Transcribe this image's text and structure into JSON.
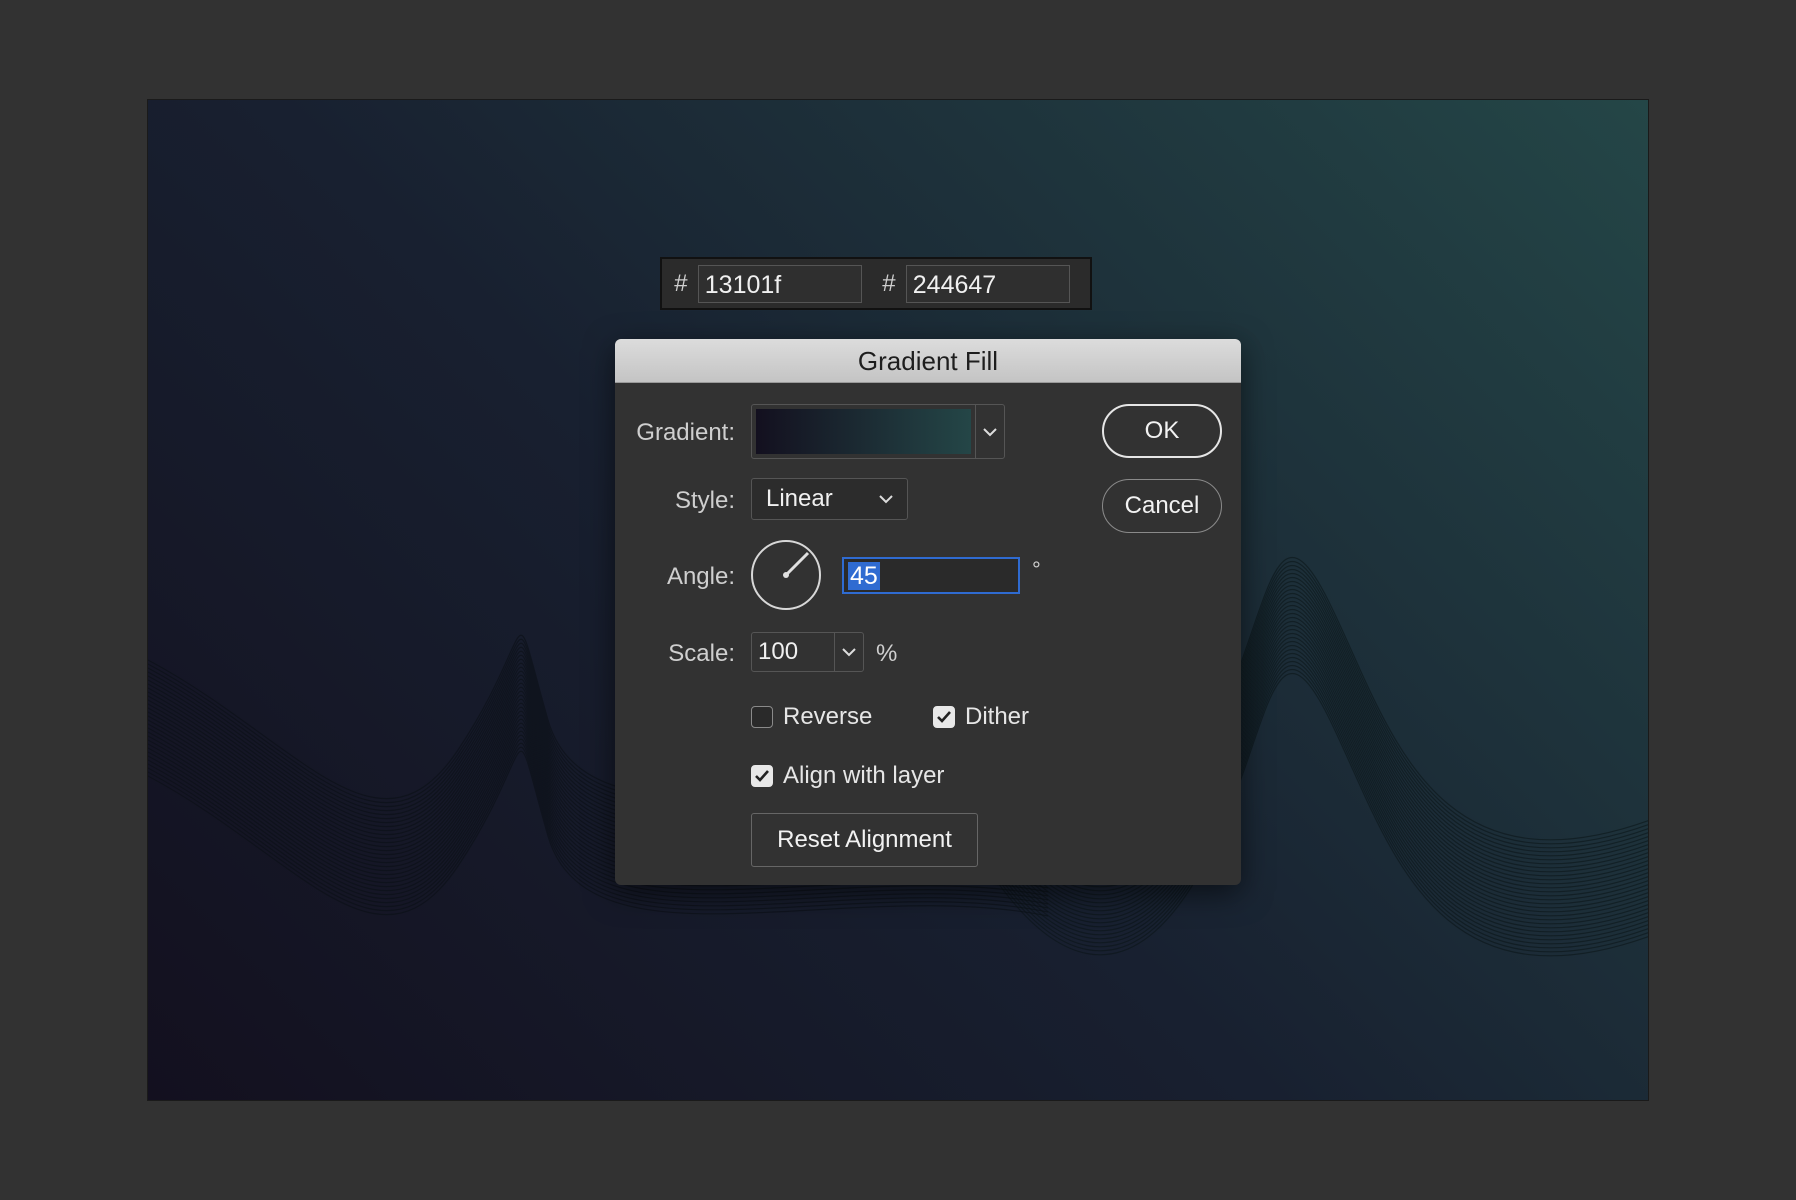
{
  "colors": {
    "start": "#13101f",
    "end": "#244647",
    "accent": "#2f6bd1"
  },
  "hex_bar": {
    "hash_symbol": "#",
    "color1": "13101f",
    "color2": "244647"
  },
  "dialog": {
    "title": "Gradient Fill",
    "gradient_label": "Gradient:",
    "style_label": "Style:",
    "style_value": "Linear",
    "angle_label": "Angle:",
    "angle_value": "45",
    "angle_unit": "°",
    "scale_label": "Scale:",
    "scale_value": "100",
    "scale_unit": "%",
    "reverse_label": "Reverse",
    "reverse_checked": false,
    "dither_label": "Dither",
    "dither_checked": true,
    "align_label": "Align with layer",
    "align_checked": true,
    "reset_label": "Reset Alignment",
    "ok_label": "OK",
    "cancel_label": "Cancel"
  }
}
